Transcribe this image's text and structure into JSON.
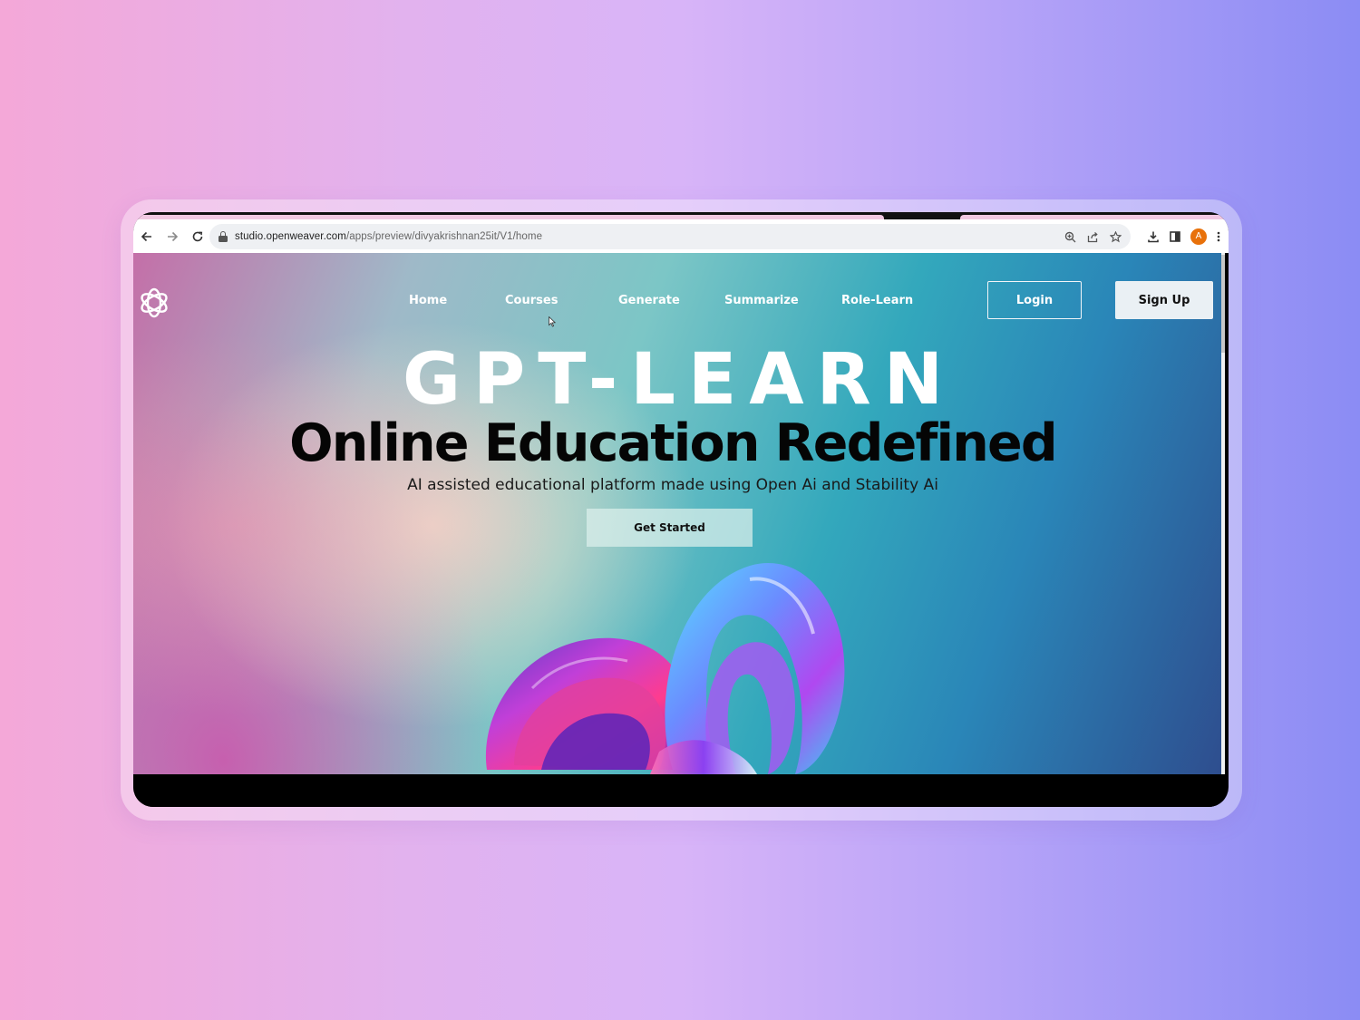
{
  "browser": {
    "url_host": "studio.openweaver.com",
    "url_path": "/apps/preview/divyakrishnan25it/V1/home",
    "profile_initial": "A",
    "icons": {
      "back": "arrow-left-icon",
      "forward": "arrow-right-icon",
      "reload": "reload-icon",
      "lock": "lock-icon",
      "zoom": "zoom-icon",
      "share": "share-icon",
      "bookmark": "star-icon",
      "download": "download-icon",
      "side_panel": "side-panel-icon",
      "menu": "kebab-menu-icon"
    }
  },
  "site": {
    "logo": "openai-logo-icon",
    "nav": [
      "Home",
      "Courses",
      "Generate",
      "Summarize",
      "Role-Learn"
    ],
    "login_label": "Login",
    "signup_label": "Sign Up",
    "hero": {
      "title": "GPT-LEARN",
      "subtitle": "Online Education Redefined",
      "tagline": "AI assisted educational platform made using Open Ai and Stability Ai",
      "cta_label": "Get Started",
      "image": "iridescent-abstract-shape"
    }
  },
  "colors": {
    "page_bg_left": "#f4a8d8",
    "page_bg_right": "#8b8cf4",
    "hero_teal": "#33a8bc",
    "hero_navy": "#2e4d8e",
    "avatar": "#e8710a"
  }
}
